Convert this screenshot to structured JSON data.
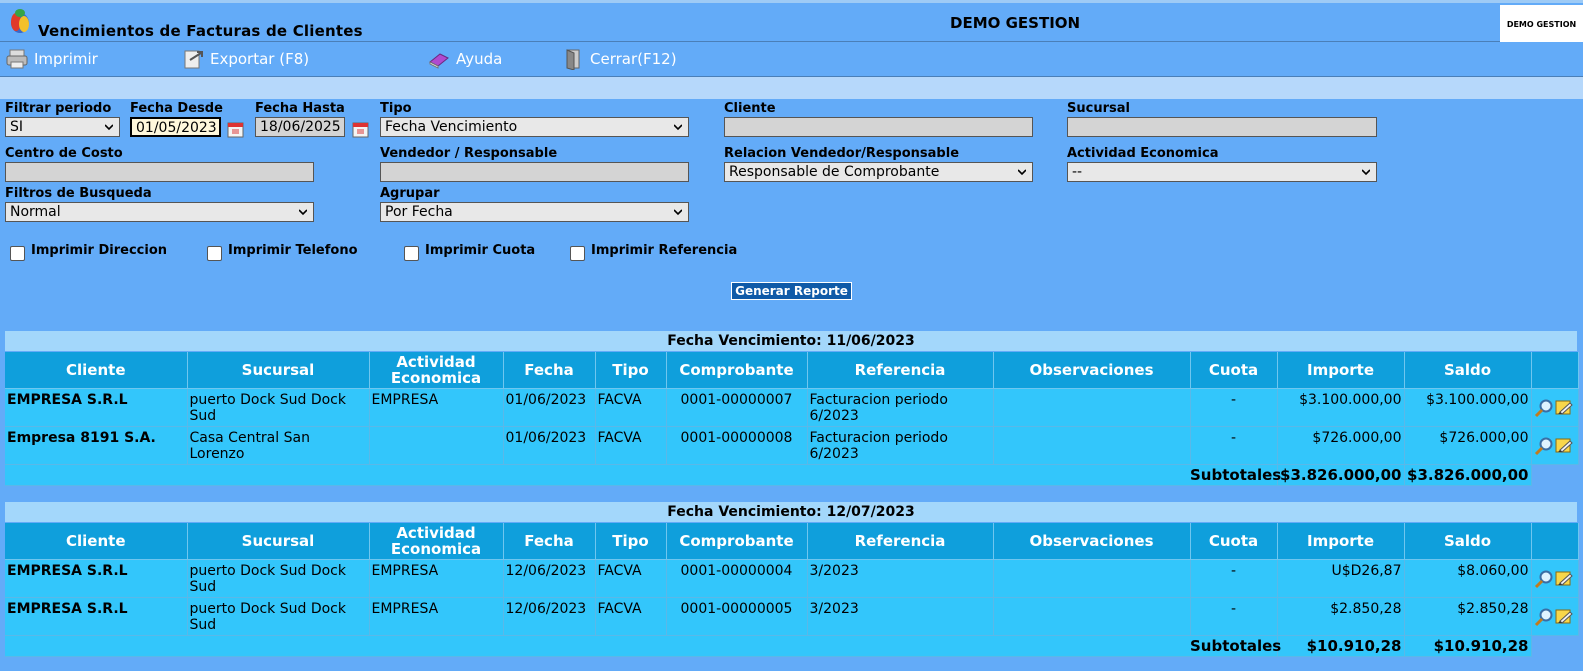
{
  "window": {
    "title": "Vencimientos de Facturas de Clientes",
    "company": "DEMO GESTION",
    "company_logo_text": "DEMO GESTION"
  },
  "toolbar": {
    "print": "Imprimir",
    "export": "Exportar (F8)",
    "help": "Ayuda",
    "close": "Cerrar(F12)"
  },
  "filters": {
    "filtrar_periodo": {
      "label": "Filtrar periodo",
      "value": "SI"
    },
    "fecha_desde": {
      "label": "Fecha Desde",
      "value": "01/05/2023"
    },
    "fecha_hasta": {
      "label": "Fecha Hasta",
      "value": "18/06/2025"
    },
    "tipo": {
      "label": "Tipo",
      "value": "Fecha Vencimiento"
    },
    "cliente": {
      "label": "Cliente",
      "value": ""
    },
    "sucursal": {
      "label": "Sucursal",
      "value": ""
    },
    "centro_costo": {
      "label": "Centro de Costo",
      "value": ""
    },
    "vendedor": {
      "label": "Vendedor / Responsable",
      "value": ""
    },
    "relacion": {
      "label": "Relacion Vendedor/Responsable",
      "value": "Responsable de Comprobante"
    },
    "actividad": {
      "label": "Actividad Economica",
      "value": "--"
    },
    "filtros_busqueda": {
      "label": "Filtros de Busqueda",
      "value": "Normal"
    },
    "agrupar": {
      "label": "Agrupar",
      "value": "Por Fecha"
    }
  },
  "options": {
    "direccion": "Imprimir Direccion",
    "telefono": "Imprimir Telefono",
    "cuota": "Imprimir Cuota",
    "referencia": "Imprimir Referencia"
  },
  "generate_button": "Generar Reporte",
  "columns": [
    "Cliente",
    "Sucursal",
    "Actividad Economica",
    "Fecha",
    "Tipo",
    "Comprobante",
    "Referencia",
    "Observaciones",
    "Cuota",
    "Importe",
    "Saldo"
  ],
  "groups": [
    {
      "header": "Fecha Vencimiento: 11/06/2023",
      "rows": [
        {
          "cliente": "EMPRESA S.R.L",
          "sucursal": "puerto Dock Sud Dock Sud",
          "actividad": "EMPRESA",
          "fecha": "01/06/2023",
          "tipo": "FACVA",
          "comprobante": "0001-00000007",
          "referencia": "Facturacion periodo 6/2023",
          "observaciones": "",
          "cuota": "-",
          "importe": "$3.100.000,00",
          "saldo": "$3.100.000,00"
        },
        {
          "cliente": "Empresa 8191 S.A.",
          "sucursal": "Casa Central San Lorenzo",
          "actividad": "",
          "fecha": "01/06/2023",
          "tipo": "FACVA",
          "comprobante": "0001-00000008",
          "referencia": "Facturacion periodo 6/2023",
          "observaciones": "",
          "cuota": "-",
          "importe": "$726.000,00",
          "saldo": "$726.000,00"
        }
      ],
      "subtotal_label": "Subtotales",
      "subtotal_importe": "$3.826.000,00",
      "subtotal_saldo": "$3.826.000,00"
    },
    {
      "header": "Fecha Vencimiento: 12/07/2023",
      "rows": [
        {
          "cliente": "EMPRESA S.R.L",
          "sucursal": "puerto Dock Sud Dock Sud",
          "actividad": "EMPRESA",
          "fecha": "12/06/2023",
          "tipo": "FACVA",
          "comprobante": "0001-00000004",
          "referencia": "3/2023",
          "observaciones": "",
          "cuota": "-",
          "importe": "U$D26,87",
          "saldo": "$8.060,00"
        },
        {
          "cliente": "EMPRESA S.R.L",
          "sucursal": "puerto Dock Sud Dock Sud",
          "actividad": "EMPRESA",
          "fecha": "12/06/2023",
          "tipo": "FACVA",
          "comprobante": "0001-00000005",
          "referencia": "3/2023",
          "observaciones": "",
          "cuota": "-",
          "importe": "$2.850,28",
          "saldo": "$2.850,28"
        }
      ],
      "subtotal_label": "Subtotales",
      "subtotal_importe": "$10.910,28",
      "subtotal_saldo": "$10.910,28"
    }
  ],
  "icons": {
    "view": "magnifier-icon",
    "edit": "edit-document-icon"
  },
  "colors": {
    "background": "#63abf8",
    "table_header": "#0f9fdc",
    "table_row": "#33c6fb",
    "group_header": "#a3d7fb",
    "button": "#0f5aa8"
  }
}
